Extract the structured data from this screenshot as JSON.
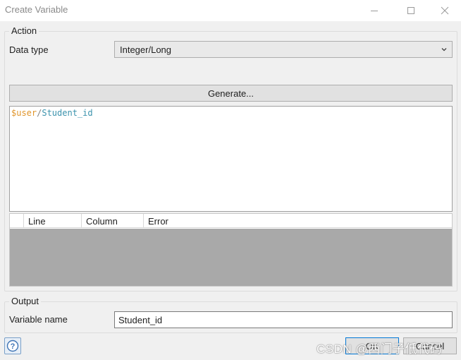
{
  "window": {
    "title": "Create Variable"
  },
  "action": {
    "legend": "Action",
    "data_type_label": "Data type",
    "data_type_value": "Integer/Long",
    "generate_label": "Generate...",
    "expression": {
      "variable": "$user",
      "separator": "/",
      "attribute": "Student_id"
    },
    "error_table": {
      "columns": [
        "",
        "Line",
        "Column",
        "Error"
      ],
      "rows": []
    }
  },
  "output": {
    "legend": "Output",
    "variable_name_label": "Variable name",
    "variable_name_value": "Student_id"
  },
  "footer": {
    "help_symbol": "?",
    "ok_label": "OK",
    "cancel_label": "Cancel"
  },
  "watermark": "CSDN @西门子低代码",
  "colors": {
    "expression_variable": "#e0952b",
    "expression_attribute": "#3c93ad",
    "error_body": "#a9a9a9",
    "ok_border": "#0078d7"
  }
}
